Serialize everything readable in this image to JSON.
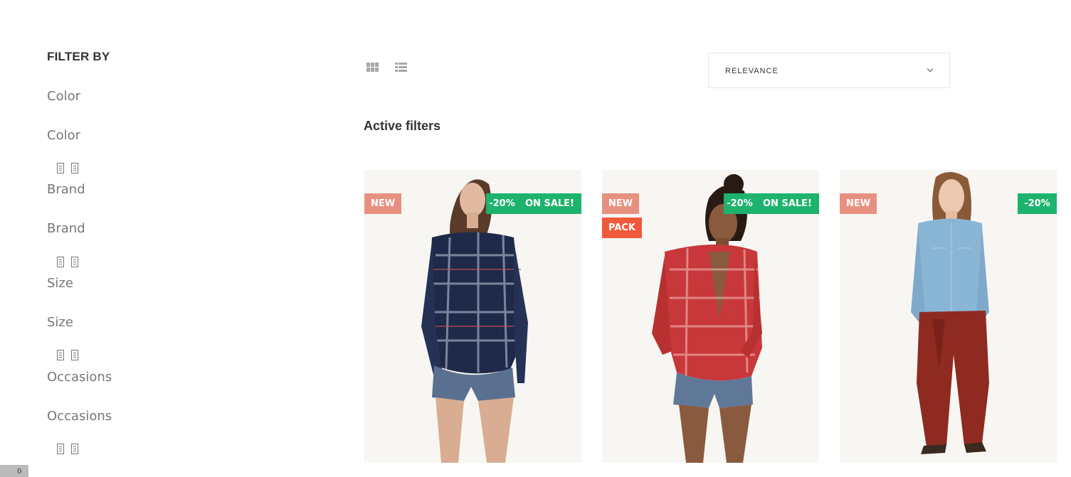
{
  "sidebar": {
    "title": "FILTER BY",
    "facets": [
      {
        "label": "Color",
        "sublabel": "Color"
      },
      {
        "label": "Brand",
        "sublabel": "Brand"
      },
      {
        "label": "Size",
        "sublabel": "Size"
      },
      {
        "label": "Occasions",
        "sublabel": "Occasions"
      }
    ]
  },
  "corner_badge": "0",
  "toolbar": {
    "grid_view_icon": "grid-icon",
    "list_view_icon": "list-icon",
    "sort_selected": "RELEVANCE"
  },
  "active_filters_label": "Active filters",
  "products": [
    {
      "flags": [
        "NEW"
      ],
      "discount": "-20%",
      "sale": "ON SALE!",
      "shirt_color": "#1f2a4a",
      "check_color": "#c9cfe0"
    },
    {
      "flags": [
        "NEW",
        "PACK"
      ],
      "discount": "-20%",
      "sale": "ON SALE!",
      "shirt_color": "#c8373a",
      "check_color": "#f2c8c0"
    },
    {
      "flags": [
        "NEW"
      ],
      "discount": "-20%",
      "sale": "",
      "shirt_color": "#8ab6d6",
      "check_color": "#a9c8e0"
    }
  ],
  "colors": {
    "new_badge": "#e89080",
    "pack_badge": "#f05a3c",
    "sale_badge": "#1db36d",
    "product_bg": "#f8f6f2"
  }
}
